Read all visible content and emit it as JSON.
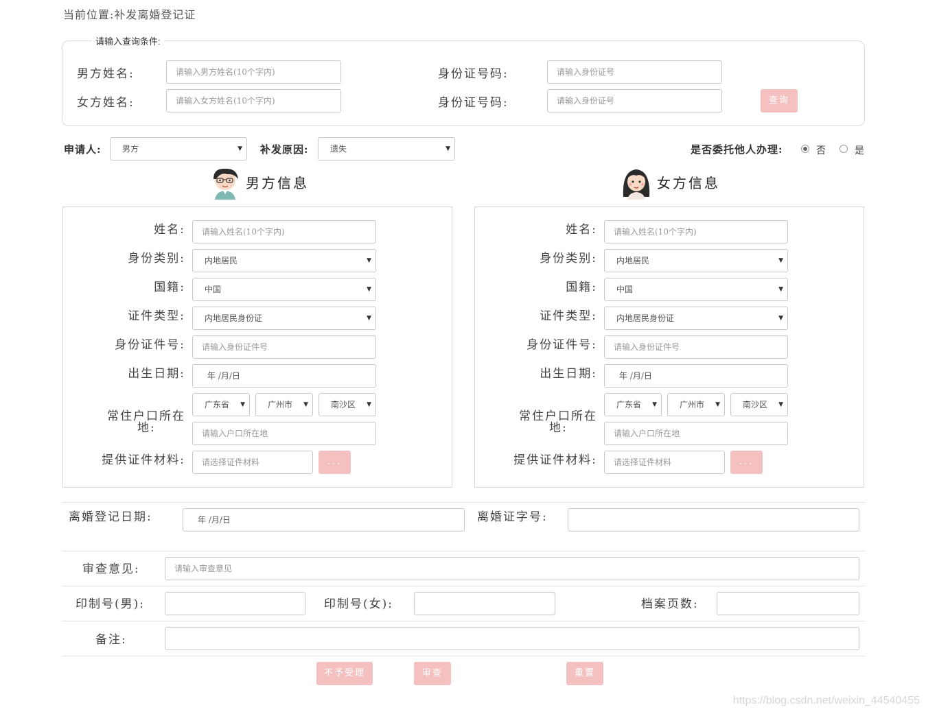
{
  "breadcrumb": "当前位置:补发离婚登记证",
  "query": {
    "legend": "请输入查询条件:",
    "male_name_label": "男方姓名:",
    "male_name_placeholder": "请输入男方姓名(10个字内)",
    "female_name_label": "女方姓名:",
    "female_name_placeholder": "请输入女方姓名(10个字内)",
    "id1_label": "身份证号码:",
    "id1_placeholder": "请输入身份证号",
    "id2_label": "身份证号码:",
    "id2_placeholder": "请输入身份证号",
    "search_button": "查询"
  },
  "applicant": {
    "label": "申请人:",
    "value": "男方",
    "reason_label": "补发原因:",
    "reason_value": "遗失",
    "entrust_label": "是否委托他人办理:",
    "option_no": "否",
    "option_yes": "是",
    "selected": "否"
  },
  "male": {
    "title": "男方信息",
    "name_label": "姓名:",
    "name_placeholder": "请输入姓名(10个字内)",
    "category_label": "身份类别:",
    "category_value": "内地居民",
    "nationality_label": "国籍:",
    "nationality_value": "中国",
    "doc_type_label": "证件类型:",
    "doc_type_value": "内地居民身份证",
    "id_label": "身份证件号:",
    "id_placeholder": "请输入身份证件号",
    "birth_label": "出生日期:",
    "birth_placeholder": "年 /月/日",
    "residence_label_1": "常住户口所在",
    "residence_label_2": "地:",
    "province": "广东省",
    "city": "广州市",
    "district": "南沙区",
    "address_placeholder": "请输入户口所在地",
    "material_label": "提供证件材料:",
    "material_placeholder": "请选择证件材料",
    "browse_button": "..."
  },
  "female": {
    "title": "女方信息",
    "name_label": "姓名:",
    "name_placeholder": "请输入姓名(10个字内)",
    "category_label": "身份类别:",
    "category_value": "内地居民",
    "nationality_label": "国籍:",
    "nationality_value": "中国",
    "doc_type_label": "证件类型:",
    "doc_type_value": "内地居民身份证",
    "id_label": "身份证件号:",
    "id_placeholder": "请输入身份证件号",
    "birth_label": "出生日期:",
    "birth_placeholder": "年 /月/日",
    "residence_label_1": "常住户口所在",
    "residence_label_2": "地:",
    "province": "广东省",
    "city": "广州市",
    "district": "南沙区",
    "address_placeholder": "请输入户口所在地",
    "material_label": "提供证件材料:",
    "material_placeholder": "请选择证件材料",
    "browse_button": "..."
  },
  "bottom": {
    "divorce_date_label": "离婚登记日期:",
    "divorce_date_placeholder": "年 /月/日",
    "cert_no_label": "离婚证字号:",
    "review_label": "审查意见:",
    "review_placeholder": "请输入审查意见",
    "print_male_label": "印制号(男):",
    "print_female_label": "印制号(女):",
    "archive_pages_label": "档案页数:",
    "remark_label": "备注:"
  },
  "actions": {
    "reject": "不予受理",
    "review": "审查",
    "reset": "重置"
  },
  "watermark": "https://blog.csdn.net/weixin_44540455",
  "colors": {
    "button_bg": "#f5c0c0",
    "border": "#c8c8c8"
  },
  "icons": {
    "male_avatar": "male-avatar-icon",
    "female_avatar": "female-avatar-icon",
    "select_arrow": "triangle-down"
  }
}
